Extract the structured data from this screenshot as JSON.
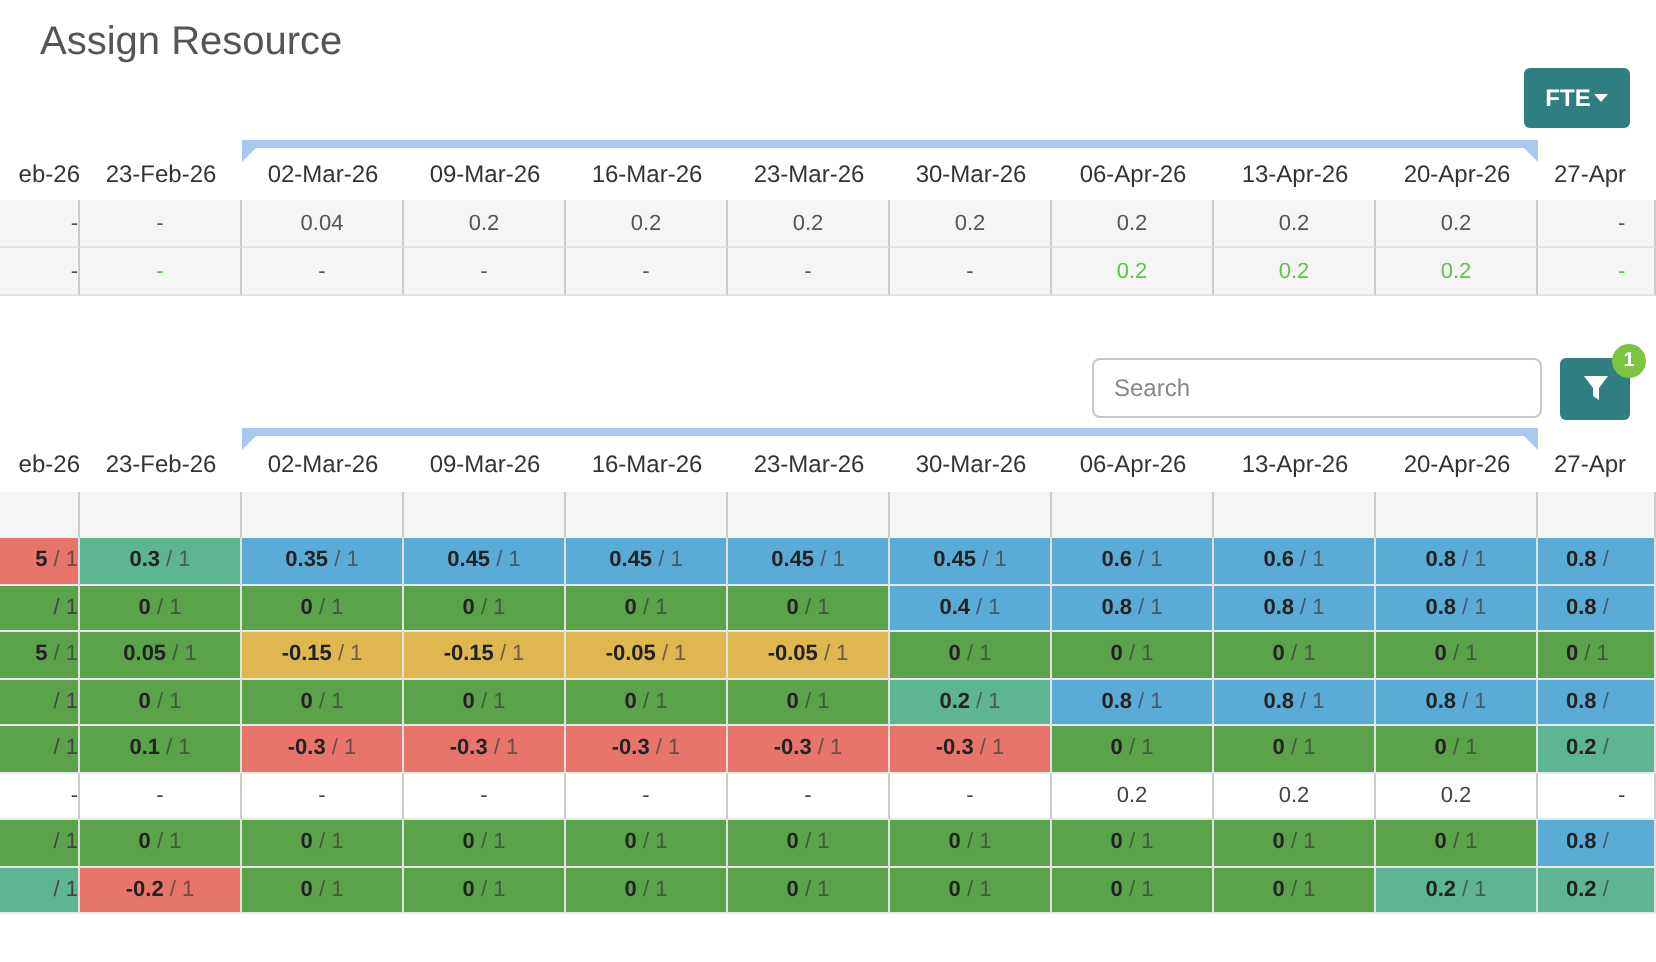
{
  "title": "Assign Resource",
  "fte_button": {
    "label": "FTE"
  },
  "top_table": {
    "columns": [
      {
        "label": "eb-26",
        "in_range": false
      },
      {
        "label": "23-Feb-26",
        "in_range": false
      },
      {
        "label": "02-Mar-26",
        "in_range": true
      },
      {
        "label": "09-Mar-26",
        "in_range": true
      },
      {
        "label": "16-Mar-26",
        "in_range": true
      },
      {
        "label": "23-Mar-26",
        "in_range": true
      },
      {
        "label": "30-Mar-26",
        "in_range": true
      },
      {
        "label": "06-Apr-26",
        "in_range": true
      },
      {
        "label": "13-Apr-26",
        "in_range": true
      },
      {
        "label": "20-Apr-26",
        "in_range": true
      },
      {
        "label": "27-Apr",
        "in_range": false
      }
    ],
    "rows": [
      [
        {
          "text": "-",
          "highlight": false
        },
        {
          "text": "-",
          "highlight": false
        },
        {
          "text": "0.04",
          "highlight": false
        },
        {
          "text": "0.2",
          "highlight": false
        },
        {
          "text": "0.2",
          "highlight": false
        },
        {
          "text": "0.2",
          "highlight": false
        },
        {
          "text": "0.2",
          "highlight": false
        },
        {
          "text": "0.2",
          "highlight": false
        },
        {
          "text": "0.2",
          "highlight": false
        },
        {
          "text": "0.2",
          "highlight": false
        },
        {
          "text": "-",
          "highlight": false
        }
      ],
      [
        {
          "text": "-",
          "highlight": false
        },
        {
          "text": "-",
          "highlight": true
        },
        {
          "text": "-",
          "highlight": false
        },
        {
          "text": "-",
          "highlight": false
        },
        {
          "text": "-",
          "highlight": false
        },
        {
          "text": "-",
          "highlight": false
        },
        {
          "text": "-",
          "highlight": false
        },
        {
          "text": "0.2",
          "highlight": true
        },
        {
          "text": "0.2",
          "highlight": true
        },
        {
          "text": "0.2",
          "highlight": true
        },
        {
          "text": "-",
          "highlight": true
        }
      ]
    ]
  },
  "search": {
    "placeholder": "Search"
  },
  "filter_button": {
    "badge": "1"
  },
  "bottom_table": {
    "columns": [
      {
        "label": "eb-26",
        "in_range": false
      },
      {
        "label": "23-Feb-26",
        "in_range": false
      },
      {
        "label": "02-Mar-26",
        "in_range": true
      },
      {
        "label": "09-Mar-26",
        "in_range": true
      },
      {
        "label": "16-Mar-26",
        "in_range": true
      },
      {
        "label": "23-Mar-26",
        "in_range": true
      },
      {
        "label": "30-Mar-26",
        "in_range": true
      },
      {
        "label": "06-Apr-26",
        "in_range": true
      },
      {
        "label": "13-Apr-26",
        "in_range": true
      },
      {
        "label": "20-Apr-26",
        "in_range": true
      },
      {
        "label": "27-Apr",
        "in_range": false
      }
    ],
    "rows": [
      [
        {
          "v": "5",
          "r": " / 1",
          "color": "#e8756a"
        },
        {
          "v": "0.3",
          "r": " / 1",
          "color": "#5db592"
        },
        {
          "v": "0.35",
          "r": " / 1",
          "color": "#5aabd6"
        },
        {
          "v": "0.45",
          "r": " / 1",
          "color": "#5aabd6"
        },
        {
          "v": "0.45",
          "r": " / 1",
          "color": "#5aabd6"
        },
        {
          "v": "0.45",
          "r": " / 1",
          "color": "#5aabd6"
        },
        {
          "v": "0.45",
          "r": " / 1",
          "color": "#5aabd6"
        },
        {
          "v": "0.6",
          "r": " / 1",
          "color": "#5aabd6"
        },
        {
          "v": "0.6",
          "r": " / 1",
          "color": "#5aabd6"
        },
        {
          "v": "0.8",
          "r": " / 1",
          "color": "#5aabd6"
        },
        {
          "v": "0.8",
          "r": " /",
          "color": "#5aabd6"
        }
      ],
      [
        {
          "r": "/ 1",
          "color": "#5aa34a"
        },
        {
          "v": "0",
          "r": " / 1",
          "color": "#5aa34a"
        },
        {
          "v": "0",
          "r": " / 1",
          "color": "#5aa34a"
        },
        {
          "v": "0",
          "r": " / 1",
          "color": "#5aa34a"
        },
        {
          "v": "0",
          "r": " / 1",
          "color": "#5aa34a"
        },
        {
          "v": "0",
          "r": " / 1",
          "color": "#5aa34a"
        },
        {
          "v": "0.4",
          "r": " / 1",
          "color": "#5aabd6"
        },
        {
          "v": "0.8",
          "r": " / 1",
          "color": "#5aabd6"
        },
        {
          "v": "0.8",
          "r": " / 1",
          "color": "#5aabd6"
        },
        {
          "v": "0.8",
          "r": " / 1",
          "color": "#5aabd6"
        },
        {
          "v": "0.8",
          "r": " /",
          "color": "#5aabd6"
        }
      ],
      [
        {
          "v": "5",
          "r": " / 1",
          "color": "#5aa34a"
        },
        {
          "v": "0.05",
          "r": " / 1",
          "color": "#5aa34a"
        },
        {
          "v": "-0.15",
          "r": " / 1",
          "color": "#dfb64f"
        },
        {
          "v": "-0.15",
          "r": " / 1",
          "color": "#dfb64f"
        },
        {
          "v": "-0.05",
          "r": " / 1",
          "color": "#dfb64f"
        },
        {
          "v": "-0.05",
          "r": " / 1",
          "color": "#dfb64f"
        },
        {
          "v": "0",
          "r": " / 1",
          "color": "#5aa34a"
        },
        {
          "v": "0",
          "r": " / 1",
          "color": "#5aa34a"
        },
        {
          "v": "0",
          "r": " / 1",
          "color": "#5aa34a"
        },
        {
          "v": "0",
          "r": " / 1",
          "color": "#5aa34a"
        },
        {
          "v": "0",
          "r": " / 1",
          "color": "#5aa34a"
        }
      ],
      [
        {
          "r": "/ 1",
          "color": "#5aa34a"
        },
        {
          "v": "0",
          "r": " / 1",
          "color": "#5aa34a"
        },
        {
          "v": "0",
          "r": " / 1",
          "color": "#5aa34a"
        },
        {
          "v": "0",
          "r": " / 1",
          "color": "#5aa34a"
        },
        {
          "v": "0",
          "r": " / 1",
          "color": "#5aa34a"
        },
        {
          "v": "0",
          "r": " / 1",
          "color": "#5aa34a"
        },
        {
          "v": "0.2",
          "r": " / 1",
          "color": "#5db592"
        },
        {
          "v": "0.8",
          "r": " / 1",
          "color": "#5aabd6"
        },
        {
          "v": "0.8",
          "r": " / 1",
          "color": "#5aabd6"
        },
        {
          "v": "0.8",
          "r": " / 1",
          "color": "#5aabd6"
        },
        {
          "v": "0.8",
          "r": " /",
          "color": "#5aabd6"
        }
      ],
      [
        {
          "r": "/ 1",
          "color": "#5aa34a"
        },
        {
          "v": "0.1",
          "r": " / 1",
          "color": "#5aa34a"
        },
        {
          "v": "-0.3",
          "r": " / 1",
          "color": "#e8756a"
        },
        {
          "v": "-0.3",
          "r": " / 1",
          "color": "#e8756a"
        },
        {
          "v": "-0.3",
          "r": " / 1",
          "color": "#e8756a"
        },
        {
          "v": "-0.3",
          "r": " / 1",
          "color": "#e8756a"
        },
        {
          "v": "-0.3",
          "r": " / 1",
          "color": "#e8756a"
        },
        {
          "v": "0",
          "r": " / 1",
          "color": "#5aa34a"
        },
        {
          "v": "0",
          "r": " / 1",
          "color": "#5aa34a"
        },
        {
          "v": "0",
          "r": " / 1",
          "color": "#5aa34a"
        },
        {
          "v": "0.2",
          "r": " /",
          "color": "#5db592"
        }
      ],
      [
        {
          "r": "-",
          "color": "#ffffff"
        },
        {
          "r": "-",
          "color": "#ffffff"
        },
        {
          "r": "-",
          "color": "#ffffff"
        },
        {
          "r": "-",
          "color": "#ffffff"
        },
        {
          "r": "-",
          "color": "#ffffff"
        },
        {
          "r": "-",
          "color": "#ffffff"
        },
        {
          "r": "-",
          "color": "#ffffff"
        },
        {
          "r": "0.2",
          "color": "#ffffff"
        },
        {
          "r": "0.2",
          "color": "#ffffff"
        },
        {
          "r": "0.2",
          "color": "#ffffff"
        },
        {
          "r": "-",
          "color": "#ffffff"
        }
      ],
      [
        {
          "r": "/ 1",
          "color": "#5aa34a"
        },
        {
          "v": "0",
          "r": " / 1",
          "color": "#5aa34a"
        },
        {
          "v": "0",
          "r": " / 1",
          "color": "#5aa34a"
        },
        {
          "v": "0",
          "r": " / 1",
          "color": "#5aa34a"
        },
        {
          "v": "0",
          "r": " / 1",
          "color": "#5aa34a"
        },
        {
          "v": "0",
          "r": " / 1",
          "color": "#5aa34a"
        },
        {
          "v": "0",
          "r": " / 1",
          "color": "#5aa34a"
        },
        {
          "v": "0",
          "r": " / 1",
          "color": "#5aa34a"
        },
        {
          "v": "0",
          "r": " / 1",
          "color": "#5aa34a"
        },
        {
          "v": "0",
          "r": " / 1",
          "color": "#5aa34a"
        },
        {
          "v": "0.8",
          "r": " /",
          "color": "#5aabd6"
        }
      ],
      [
        {
          "r": "/ 1",
          "color": "#5db592"
        },
        {
          "v": "-0.2",
          "r": " / 1",
          "color": "#e8756a"
        },
        {
          "v": "0",
          "r": " / 1",
          "color": "#5aa34a"
        },
        {
          "v": "0",
          "r": " / 1",
          "color": "#5aa34a"
        },
        {
          "v": "0",
          "r": " / 1",
          "color": "#5aa34a"
        },
        {
          "v": "0",
          "r": " / 1",
          "color": "#5aa34a"
        },
        {
          "v": "0",
          "r": " / 1",
          "color": "#5aa34a"
        },
        {
          "v": "0",
          "r": " / 1",
          "color": "#5aa34a"
        },
        {
          "v": "0",
          "r": " / 1",
          "color": "#5aa34a"
        },
        {
          "v": "0.2",
          "r": " / 1",
          "color": "#5db592"
        },
        {
          "v": "0.2",
          "r": " /",
          "color": "#5db592"
        }
      ]
    ]
  }
}
